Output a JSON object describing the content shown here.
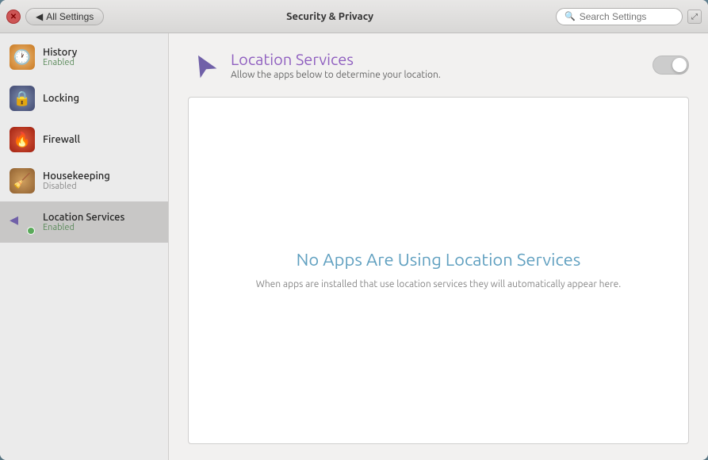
{
  "window": {
    "title": "Security & Privacy",
    "close_label": "✕",
    "back_label": "All Settings",
    "maximize_label": "⤢"
  },
  "search": {
    "placeholder": "Search Settings"
  },
  "sidebar": {
    "items": [
      {
        "id": "history",
        "label": "History",
        "sublabel": "Enabled",
        "sublabel_class": "enabled",
        "icon_class": "icon-history",
        "icon_glyph": "🕐"
      },
      {
        "id": "locking",
        "label": "Locking",
        "sublabel": "",
        "icon_class": "icon-locking",
        "icon_glyph": "🔒"
      },
      {
        "id": "firewall",
        "label": "Firewall",
        "sublabel": "",
        "icon_class": "icon-firewall",
        "icon_glyph": "🔥"
      },
      {
        "id": "housekeeping",
        "label": "Housekeeping",
        "sublabel": "Disabled",
        "sublabel_class": "disabled",
        "icon_class": "icon-housekeeping",
        "icon_glyph": "🧹"
      },
      {
        "id": "location-services",
        "label": "Location Services",
        "sublabel": "Enabled",
        "sublabel_class": "enabled",
        "icon_class": "icon-location",
        "active": true
      }
    ]
  },
  "main": {
    "section_title": "Location Services",
    "section_desc": "Allow the apps below to determine your location.",
    "toggle_state": "off",
    "empty_title": "No Apps Are Using Location Services",
    "empty_desc": "When apps are installed that use location services they will automatically appear here."
  }
}
